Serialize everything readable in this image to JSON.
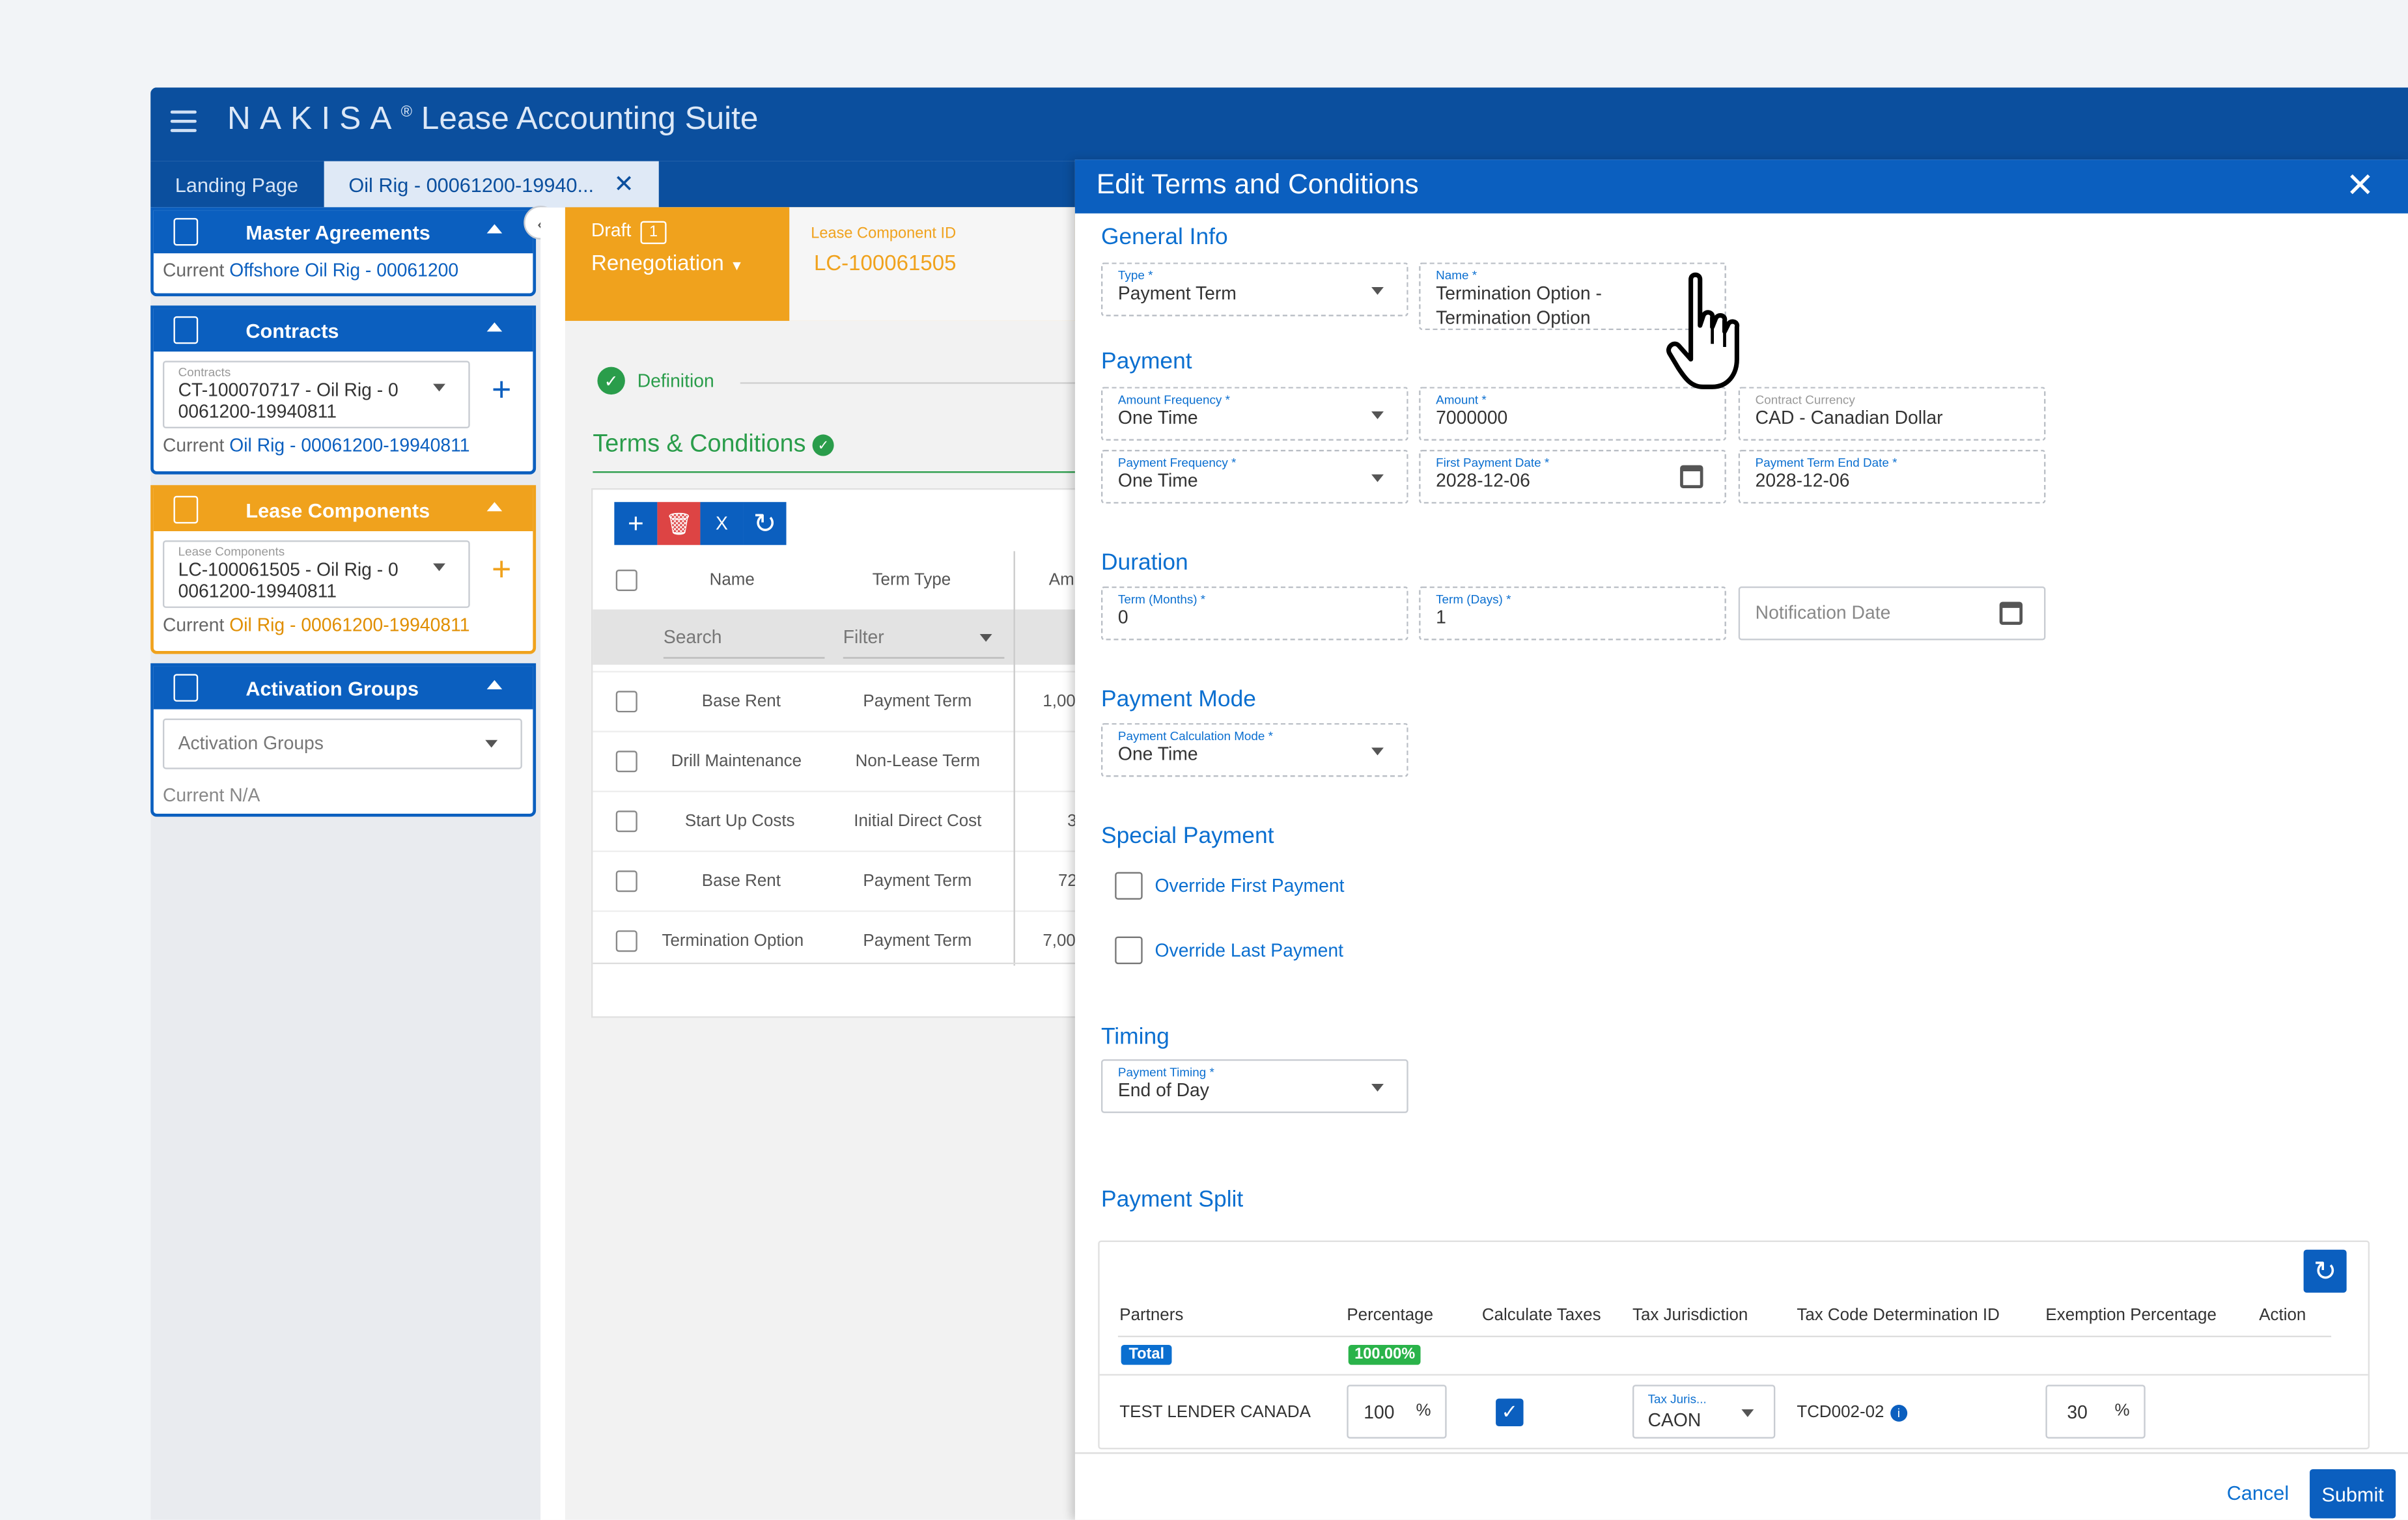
{
  "app": {
    "brand": "NAKISA",
    "reg": "®",
    "suite": "Lease Accounting Suite"
  },
  "tabs": [
    {
      "label": "Landing Page"
    },
    {
      "label": "Oil Rig - 00061200-19940...",
      "close": "✕"
    }
  ],
  "sidebar": {
    "master": {
      "title": "Master Agreements",
      "current_label": "Current",
      "current_value": "Offshore Oil Rig - 00061200"
    },
    "contracts": {
      "title": "Contracts",
      "select_label": "Contracts",
      "select_value_line1": "CT-100070717 - Oil Rig - 0",
      "select_value_line2": "0061200-19940811",
      "current_label": "Current",
      "current_value": "Oil Rig - 00061200-19940811"
    },
    "lease_components": {
      "title": "Lease Components",
      "select_label": "Lease Components",
      "select_value_line1": "LC-100061505 - Oil Rig - 0",
      "select_value_line2": "0061200-19940811",
      "current_label": "Current",
      "current_value": "Oil Rig - 00061200-19940811"
    },
    "activation": {
      "title": "Activation Groups",
      "select_value": "Activation Groups",
      "current": "Current N/A"
    }
  },
  "status": {
    "draft": "Draft",
    "draft_badge": "1",
    "mode": "Renegotiation",
    "lc_label": "Lease Component ID",
    "lc_value": "LC-100061505"
  },
  "steps": {
    "definition": "Definition",
    "terms": "Terms & Conditions"
  },
  "grid": {
    "headers": {
      "name": "Name",
      "term_type": "Term Type",
      "amount": "Am"
    },
    "search_placeholder": "Search",
    "filter_placeholder": "Filter",
    "rows": [
      {
        "name": "Base Rent",
        "type": "Payment Term",
        "amount": "1,00"
      },
      {
        "name": "Drill Maintenance",
        "type": "Non-Lease Term",
        "amount": ""
      },
      {
        "name": "Start Up Costs",
        "type": "Initial Direct Cost",
        "amount": "3"
      },
      {
        "name": "Base Rent",
        "type": "Payment Term",
        "amount": "72"
      },
      {
        "name": "Termination Option",
        "type": "Payment Term",
        "amount": "7,00"
      }
    ]
  },
  "modal": {
    "title": "Edit Terms and Conditions",
    "close": "✕",
    "general": {
      "heading": "General Info",
      "type_label": "Type *",
      "type_value": "Payment Term",
      "name_label": "Name *",
      "name_line1": "Termination Option -",
      "name_line2": "Termination Option"
    },
    "payment": {
      "heading": "Payment",
      "amount_freq_label": "Amount Frequency *",
      "amount_freq_value": "One Time",
      "amount_label": "Amount *",
      "amount_value": "7000000",
      "currency_label": "Contract Currency",
      "currency_value": "CAD - Canadian Dollar",
      "pay_freq_label": "Payment Frequency *",
      "pay_freq_value": "One Time",
      "first_date_label": "First Payment Date *",
      "first_date_value": "2028-12-06",
      "end_date_label": "Payment Term End Date *",
      "end_date_value": "2028-12-06"
    },
    "duration": {
      "heading": "Duration",
      "months_label": "Term (Months) *",
      "months_value": "0",
      "days_label": "Term (Days) *",
      "days_value": "1",
      "notification_placeholder": "Notification Date"
    },
    "mode": {
      "heading": "Payment Mode",
      "calc_label": "Payment Calculation Mode *",
      "calc_value": "One Time"
    },
    "special": {
      "heading": "Special Payment",
      "override_first": "Override First Payment",
      "override_last": "Override Last Payment"
    },
    "timing": {
      "heading": "Timing",
      "label": "Payment Timing *",
      "value": "End of Day"
    },
    "split": {
      "heading": "Payment Split",
      "headers": [
        "Partners",
        "Percentage",
        "Calculate Taxes",
        "Tax Jurisdiction",
        "Tax Code Determination ID",
        "Exemption Percentage",
        "Action"
      ],
      "total_label": "Total",
      "total_pct": "100.00%",
      "row": {
        "partner": "TEST LENDER CANADA",
        "percentage": "100",
        "pct_sign": "%",
        "tax_juris_label": "Tax Juris...",
        "tax_juris_value": "CAON",
        "tax_code": "TCD002-02",
        "exemption": "30",
        "exempt_sign": "%"
      }
    },
    "footer": {
      "cancel": "Cancel",
      "submit": "Submit"
    }
  },
  "colors": {
    "brand_blue": "#0b4f9e",
    "primary": "#0b5fbf",
    "orange": "#f0a21d",
    "green": "#2a9d4b"
  }
}
